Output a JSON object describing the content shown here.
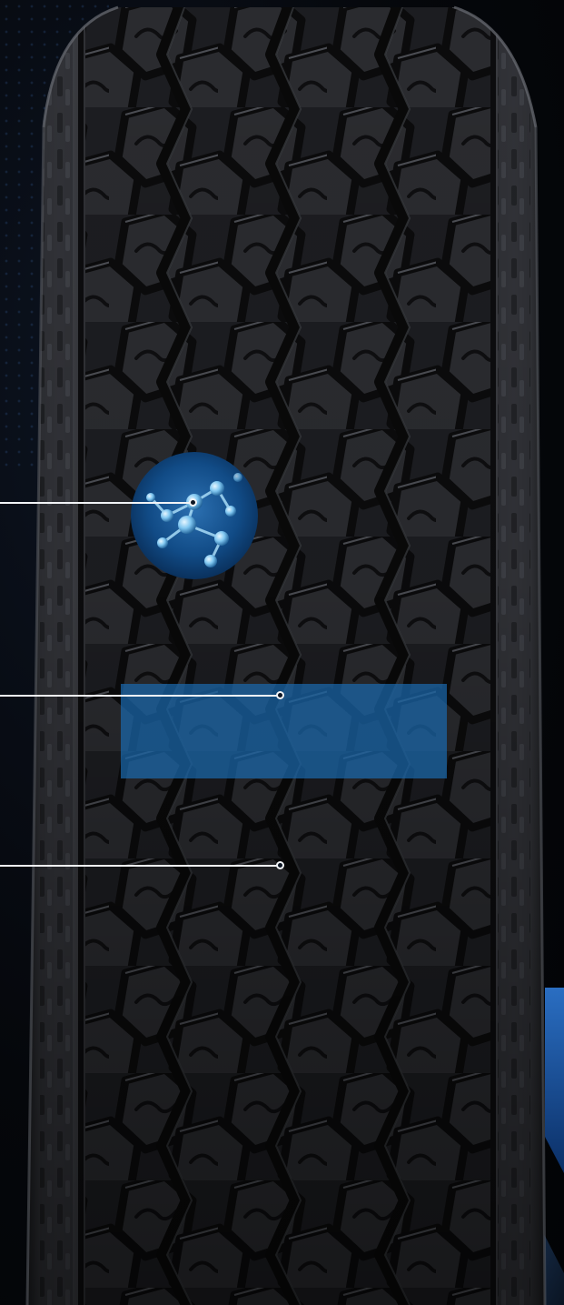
{
  "scene": {
    "subject": "tire-tread-front",
    "colors": {
      "background": "#05070b",
      "rubber": "#1c1d20",
      "rubber_light": "#3a3c41",
      "accent_blue": "#1a68ac",
      "callout": "#f2f4f7"
    },
    "icons": [
      "molecule-icon"
    ]
  }
}
